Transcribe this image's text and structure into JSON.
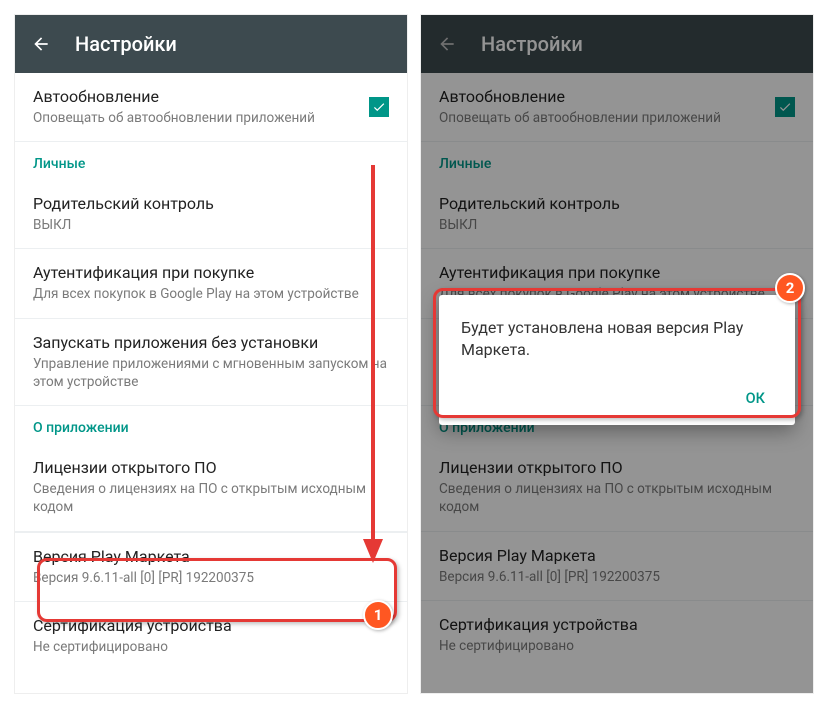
{
  "appbar": {
    "title": "Настройки"
  },
  "items": {
    "autoupdate": {
      "title": "Автообновление",
      "sub": "Оповещать об автообновлении приложений"
    },
    "section_personal": "Личные",
    "parental": {
      "title": "Родительский контроль",
      "sub": "ВЫКЛ"
    },
    "auth": {
      "title": "Аутентификация при покупке",
      "sub": "Для всех покупок в Google Play на этом устройстве"
    },
    "instant": {
      "title": "Запускать приложения без установки",
      "sub": "Управление приложениями с мгновенным запуском на этом устройстве"
    },
    "section_about": "О приложении",
    "licenses": {
      "title": "Лицензии открытого ПО",
      "sub": "Сведения о лицензиях на ПО с открытым исходным кодом"
    },
    "version": {
      "title": "Версия Play Маркета",
      "sub": "Версия 9.6.11-all [0] [PR] 192200375"
    },
    "cert": {
      "title": "Сертификация устройства",
      "sub": "Не сертифицировано"
    }
  },
  "dialog": {
    "message": "Будет установлена новая версия Play Маркета.",
    "ok": "ОК"
  },
  "badges": {
    "one": "1",
    "two": "2"
  }
}
